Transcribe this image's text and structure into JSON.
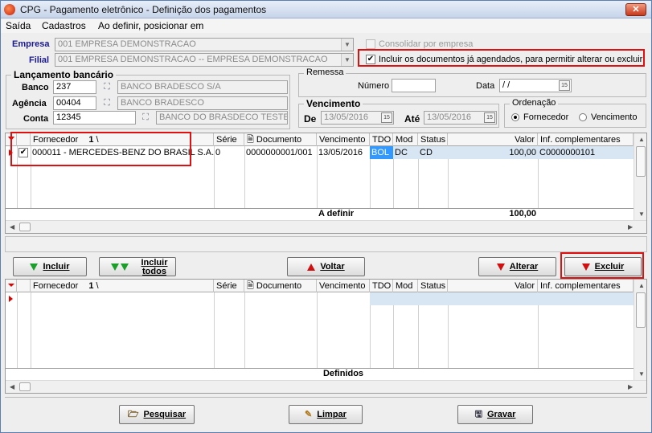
{
  "window": {
    "title": "CPG - Pagamento eletrônico - Definição dos pagamentos",
    "close_label": "✕"
  },
  "menu": [
    "Saída",
    "Cadastros",
    "Ao definir, posicionar em"
  ],
  "top": {
    "empresa_label": "Empresa",
    "empresa_value": "001 EMPRESA DEMONSTRACAO",
    "filial_label": "Filial",
    "filial_value": "001 EMPRESA DEMONSTRACAO -- EMPRESA DEMONSTRACAO",
    "consolidar_label": "Consolidar por empresa",
    "incluir_agendados_label": "Incluir os documentos já agendados, para permitir alterar ou excluir",
    "incluir_agendados_checked": true
  },
  "lancamento": {
    "title": "Lançamento bancário",
    "banco_label": "Banco",
    "banco_code": "237",
    "banco_name": "BANCO BRADESCO S/A",
    "agencia_label": "Agência",
    "agencia_code": "00404",
    "agencia_name": "BANCO BRADESCO",
    "conta_label": "Conta",
    "conta_code": "12345",
    "conta_name": "BANCO DO BRASDECO TESTE"
  },
  "remessa": {
    "title": "Remessa",
    "numero_label": "Número",
    "numero_value": "",
    "data_label": "Data",
    "data_value": " /  /"
  },
  "vencimento": {
    "title": "Vencimento",
    "de_label": "De",
    "de_value": "13/05/2016",
    "ate_label": "Até",
    "ate_value": "13/05/2016"
  },
  "ordenacao": {
    "title": "Ordenação",
    "options": [
      "Fornecedor",
      "Vencimento"
    ],
    "selected": "Fornecedor"
  },
  "grid_columns": {
    "fornecedor": "Fornecedor",
    "fornecedor_sort": "1",
    "serie": "Série",
    "documento": "Documento",
    "vencimento": "Vencimento",
    "tdo": "TDO",
    "mod": "Mod",
    "status": "Status",
    "valor": "Valor",
    "inf": "Inf. complementares"
  },
  "grid_top": {
    "rows": [
      {
        "checked": true,
        "fornecedor": "000011 - MERCEDES-BENZ DO BRASIL S.A.",
        "serie": "0",
        "documento": "0000000001/001",
        "vencimento": "13/05/2016",
        "tdo": "BOL",
        "mod": "DC",
        "status": "CD",
        "valor": "100,00",
        "inf": "C0000000101"
      }
    ],
    "footer_label": "A definir",
    "footer_total": "100,00"
  },
  "buttons_mid": {
    "incluir": "Incluir",
    "incluir_todos_line1": "Incluir",
    "incluir_todos_line2": "todos",
    "voltar": "Voltar",
    "alterar": "Alterar",
    "excluir": "Excluir"
  },
  "grid_bottom": {
    "rows": [],
    "footer_label": "Definidos"
  },
  "buttons_bottom": {
    "pesquisar": "Pesquisar",
    "limpar": "Limpar",
    "gravar": "Gravar"
  },
  "colors": {
    "highlight": "#e01010",
    "selected_cell": "#3399ff",
    "label_blue": "#1a1a8a"
  }
}
